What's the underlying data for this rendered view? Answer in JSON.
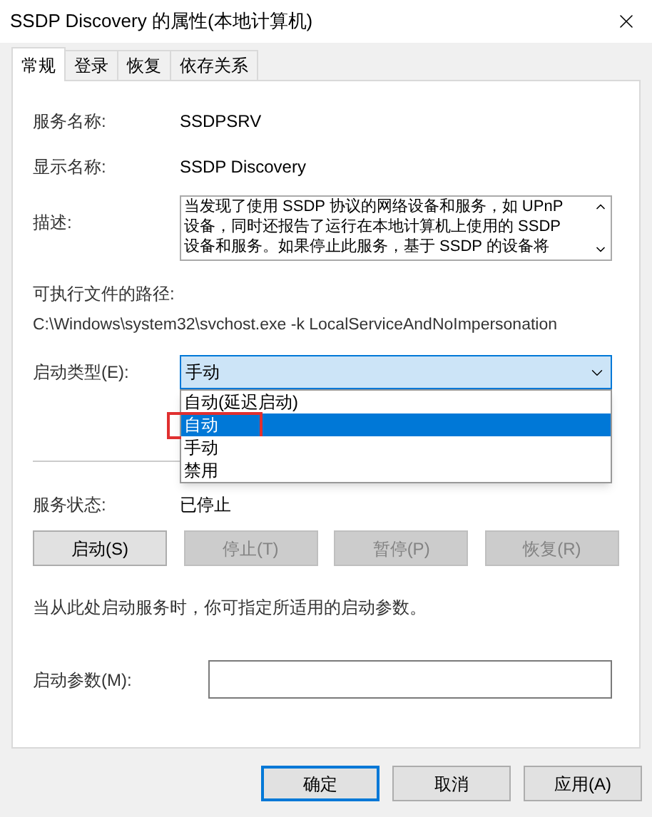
{
  "window": {
    "title": "SSDP Discovery 的属性(本地计算机)"
  },
  "tabs": [
    {
      "label": "常规",
      "selected": true
    },
    {
      "label": "登录",
      "selected": false
    },
    {
      "label": "恢复",
      "selected": false
    },
    {
      "label": "依存关系",
      "selected": false
    }
  ],
  "general": {
    "service_name": {
      "label": "服务名称:",
      "value": "SSDPSRV"
    },
    "display_name": {
      "label": "显示名称:",
      "value": "SSDP Discovery"
    },
    "description": {
      "label": "描述:",
      "lines": [
        "当发现了使用 SSDP 协议的网络设备和服务，如 UPnP",
        "设备，同时还报告了运行在本地计算机上使用的 SSDP",
        "设备和服务。如果停止此服务，基于 SSDP 的设备将"
      ]
    },
    "path": {
      "label": "可执行文件的路径:",
      "value": "C:\\Windows\\system32\\svchost.exe -k LocalServiceAndNoImpersonation"
    },
    "startup_type": {
      "label": "启动类型(E):",
      "value": "手动",
      "expanded": true,
      "options": [
        {
          "label": "自动(延迟启动)",
          "highlighted": false,
          "outlined": false
        },
        {
          "label": "自动",
          "highlighted": true,
          "outlined": true
        },
        {
          "label": "手动",
          "highlighted": false,
          "outlined": false
        },
        {
          "label": "禁用",
          "highlighted": false,
          "outlined": false
        }
      ]
    },
    "service_status": {
      "label": "服务状态:",
      "value": "已停止"
    },
    "service_buttons": [
      {
        "label": "启动(S)",
        "disabled": false
      },
      {
        "label": "停止(T)",
        "disabled": true
      },
      {
        "label": "暂停(P)",
        "disabled": true
      },
      {
        "label": "恢复(R)",
        "disabled": true
      }
    ],
    "hint": "当从此处启动服务时，你可指定所适用的启动参数。",
    "start_params": {
      "label": "启动参数(M):"
    }
  },
  "buttons": [
    {
      "label": "确定",
      "default": true,
      "disabled": false
    },
    {
      "label": "取消",
      "default": false,
      "disabled": false
    },
    {
      "label": "应用(A)",
      "default": false,
      "disabled": false
    }
  ]
}
